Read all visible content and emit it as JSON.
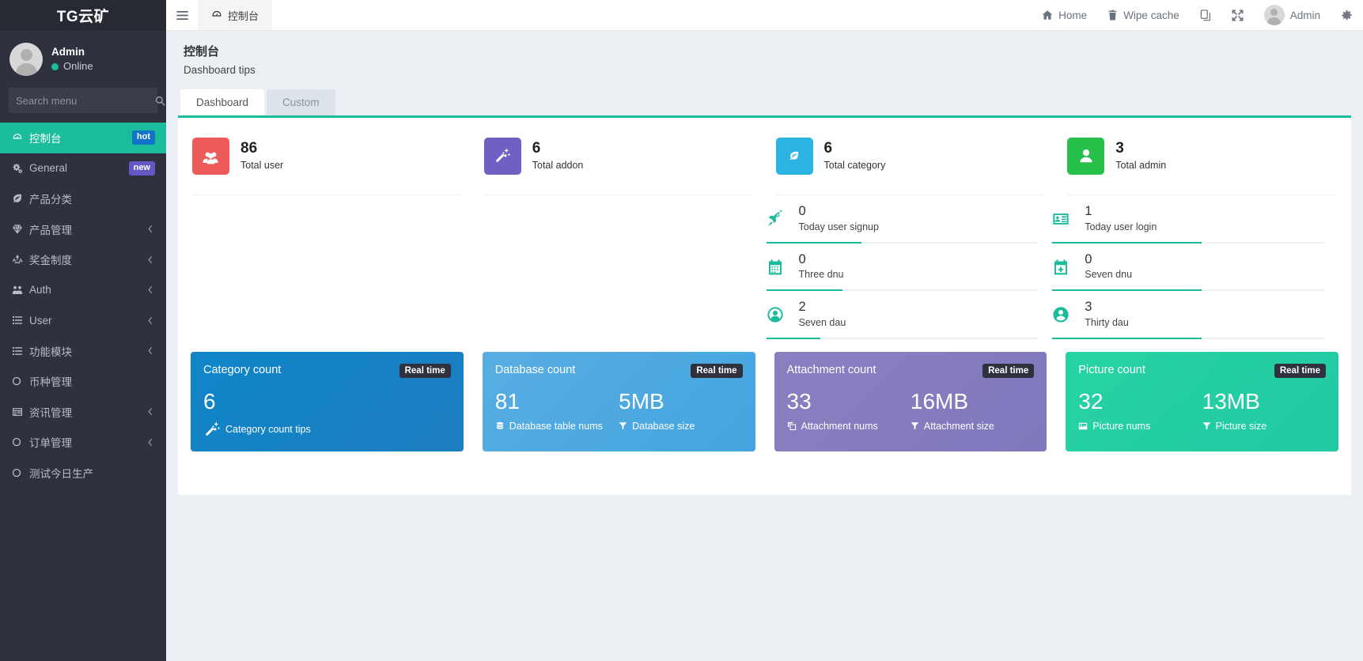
{
  "sidebar": {
    "brand": "TG云矿",
    "user": {
      "name": "Admin",
      "status": "Online"
    },
    "search": {
      "placeholder": "Search menu",
      "value": "",
      "icon": "search-icon"
    },
    "items": [
      {
        "label": "控制台",
        "icon": "dashboard-icon",
        "badge": "hot",
        "badge_color": "#1274c9",
        "active": true,
        "caret": false
      },
      {
        "label": "General",
        "icon": "gears-icon",
        "badge": "new",
        "badge_color": "#6658c4",
        "active": false,
        "caret": false
      },
      {
        "label": "产品分类",
        "icon": "leaf-icon",
        "badge": "",
        "active": false,
        "caret": false
      },
      {
        "label": "产品管理",
        "icon": "diamond-icon",
        "badge": "",
        "active": false,
        "caret": true
      },
      {
        "label": "奖金制度",
        "icon": "recycle-icon",
        "badge": "",
        "active": false,
        "caret": true
      },
      {
        "label": "Auth",
        "icon": "users-gear-icon",
        "badge": "",
        "active": false,
        "caret": true
      },
      {
        "label": "User",
        "icon": "list-icon",
        "badge": "",
        "active": false,
        "caret": true
      },
      {
        "label": "功能模块",
        "icon": "list-icon",
        "badge": "",
        "active": false,
        "caret": true
      },
      {
        "label": "币种管理",
        "icon": "circle-icon",
        "badge": "",
        "active": false,
        "caret": false
      },
      {
        "label": "资讯管理",
        "icon": "window-icon",
        "badge": "",
        "active": false,
        "caret": true
      },
      {
        "label": "订单管理",
        "icon": "circle-icon",
        "badge": "",
        "active": false,
        "caret": true
      },
      {
        "label": "测试今日生产",
        "icon": "circle-icon",
        "badge": "",
        "active": false,
        "caret": false
      }
    ]
  },
  "navbar": {
    "burger_icon": "hamburger-icon",
    "tab": {
      "label": "控制台",
      "icon": "dashboard-icon"
    },
    "links": [
      {
        "label": "Home",
        "icon": "home-icon"
      },
      {
        "label": "Wipe cache",
        "icon": "trash-icon"
      },
      {
        "label": "",
        "icon": "copy-icon"
      },
      {
        "label": "",
        "icon": "fullscreen-icon"
      }
    ],
    "user": {
      "label": "Admin",
      "avatar": "avatar"
    },
    "settings_icon": "gear-icon"
  },
  "page": {
    "title": "控制台",
    "subtitle": "Dashboard tips",
    "tabs": [
      {
        "label": "Dashboard",
        "active": true
      },
      {
        "label": "Custom",
        "active": false
      }
    ]
  },
  "stats": [
    {
      "value": "86",
      "label": "Total user",
      "icon": "group-icon",
      "color": "#ec5a5a"
    },
    {
      "value": "6",
      "label": "Total addon",
      "icon": "magic-icon",
      "color": "#7060c4"
    },
    {
      "value": "6",
      "label": "Total category",
      "icon": "leaf-icon",
      "color": "#2bb3e3"
    },
    {
      "value": "3",
      "label": "Total admin",
      "icon": "person-icon",
      "color": "#27c04a"
    }
  ],
  "user_metrics": [
    {
      "value": "0",
      "label": "Today user signup",
      "icon": "rocket-icon",
      "progress": 35
    },
    {
      "value": "1",
      "label": "Today user login",
      "icon": "id-card-icon",
      "progress": 55
    },
    {
      "value": "0",
      "label": "Three dnu",
      "icon": "calendar-icon",
      "progress": 28
    },
    {
      "value": "0",
      "label": "Seven dnu",
      "icon": "calendar-plus-icon",
      "progress": 55
    },
    {
      "value": "2",
      "label": "Seven dau",
      "icon": "user-circle-icon",
      "progress": 20
    },
    {
      "value": "3",
      "label": "Thirty dau",
      "icon": "user-circle-solid-icon",
      "progress": 55
    }
  ],
  "count_cards": [
    {
      "title": "Category count",
      "badge": "Real time",
      "color_from": "#0f86c8",
      "color_to": "#1c7dc0",
      "metrics": [
        {
          "value": "6",
          "caption": "Category count tips",
          "icon": "magic-icon"
        }
      ]
    },
    {
      "title": "Database count",
      "badge": "Real time",
      "color_from": "#58aee2",
      "color_to": "#44a4df",
      "metrics": [
        {
          "value": "81",
          "caption": "Database table nums",
          "icon": "database-icon"
        },
        {
          "value": "5MB",
          "caption": "Database size",
          "icon": "filter-icon"
        }
      ]
    },
    {
      "title": "Attachment count",
      "badge": "Real time",
      "color_from": "#8b7fc0",
      "color_to": "#7f79bd",
      "metrics": [
        {
          "value": "33",
          "caption": "Attachment nums",
          "icon": "clone-icon"
        },
        {
          "value": "16MB",
          "caption": "Attachment size",
          "icon": "filter-icon"
        }
      ]
    },
    {
      "title": "Picture count",
      "badge": "Real time",
      "color_from": "#27d3a2",
      "color_to": "#21c9a4",
      "metrics": [
        {
          "value": "32",
          "caption": "Picture nums",
          "icon": "image-icon"
        },
        {
          "value": "13MB",
          "caption": "Picture size",
          "icon": "filter-icon"
        }
      ]
    }
  ],
  "theme": {
    "accent": "#1abc9c",
    "sidebar_bg": "#2f323e",
    "page_bg": "#ecf0f5"
  }
}
